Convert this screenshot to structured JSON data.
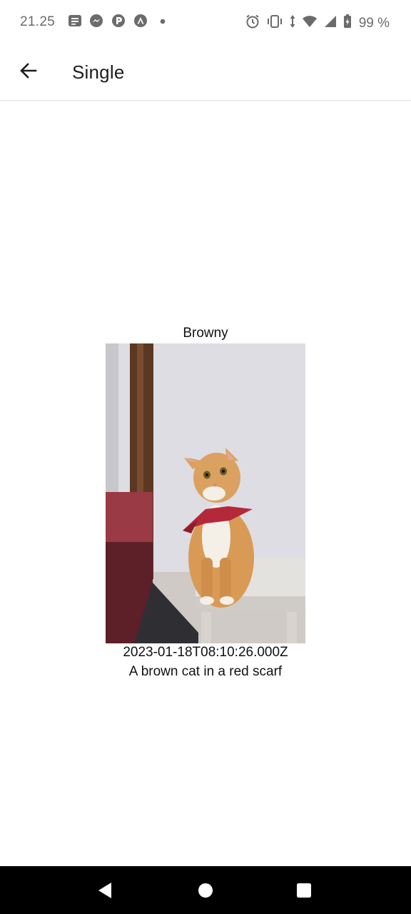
{
  "status_bar": {
    "time": "21.25",
    "battery_text": "99 %",
    "left_icons": [
      "news-icon",
      "messenger-icon",
      "pocket-casts-icon",
      "arc-icon",
      "dot-icon"
    ],
    "right_icons": [
      "alarm-icon",
      "vibrate-icon",
      "data-arrows-icon",
      "wifi-icon",
      "signal-icon",
      "battery-charging-icon"
    ]
  },
  "appbar": {
    "title": "Single",
    "back_icon": "arrow-back-icon"
  },
  "item": {
    "name": "Browny",
    "date": "2023-01-18T08:10:26.000Z",
    "description": "A brown cat in a red scarf"
  },
  "navbar": {
    "icons": [
      "back-triangle-icon",
      "home-circle-icon",
      "recents-square-icon"
    ]
  },
  "colors": {
    "background": "#ffffff",
    "text": "#111111",
    "status_text": "#6b6b6b",
    "navbar": "#000000",
    "scarf_red": "#b5283a",
    "cat_orange": "#d99a55"
  }
}
